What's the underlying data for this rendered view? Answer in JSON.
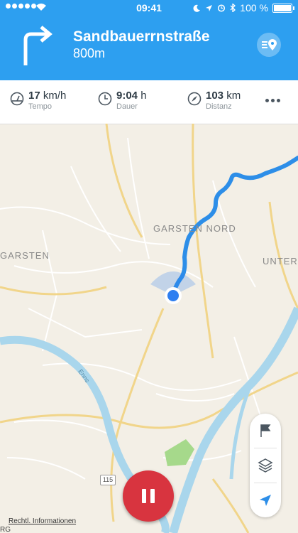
{
  "status_bar": {
    "time": "09:41",
    "battery_label": "100 %"
  },
  "navigation": {
    "street": "Sandbauerrnstraße",
    "distance_to_turn": "800m",
    "maneuver_icon": "turn-right-arrow-icon"
  },
  "stats": [
    {
      "value": "17",
      "unit": "km/h",
      "label": "Tempo",
      "icon": "speedometer-icon"
    },
    {
      "value": "9:04",
      "unit": "h",
      "label": "Dauer",
      "icon": "clock-icon"
    },
    {
      "value": "103",
      "unit": "km",
      "label": "Distanz",
      "icon": "compass-icon"
    }
  ],
  "map": {
    "labels": {
      "garsten": "GARSTEN",
      "garsten_nord": "GARSTEN NORD",
      "unterh": "UNTERH",
      "enns": "Enns",
      "road_number": "115",
      "attribution": "Rechtl. Informationen",
      "corner_fragment": "RG"
    },
    "route_color": "#2d8ee8",
    "location_color": "#2f7ff0"
  },
  "controls": {
    "flag": "flag-icon",
    "layers": "layers-icon",
    "locate": "location-arrow-icon"
  },
  "colors": {
    "header": "#2d9ff0",
    "pause_button": "#d8343f"
  }
}
